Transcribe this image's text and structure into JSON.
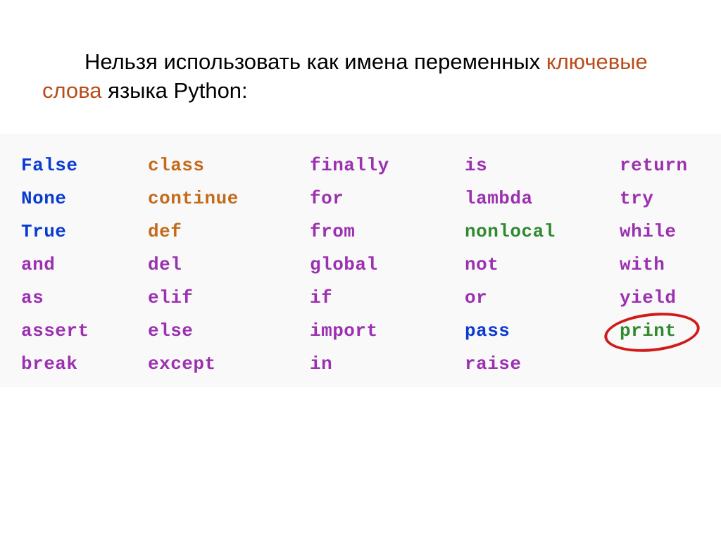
{
  "intro": {
    "part1": "Нельзя использовать как имена переменных ",
    "highlight": "ключевые слова",
    "part2": " языка Python:"
  },
  "keywords": [
    {
      "text": "False",
      "color": "blue",
      "col": 0,
      "row": 0
    },
    {
      "text": "None",
      "color": "blue",
      "col": 0,
      "row": 1
    },
    {
      "text": "True",
      "color": "blue",
      "col": 0,
      "row": 2
    },
    {
      "text": "and",
      "color": "purple",
      "col": 0,
      "row": 3
    },
    {
      "text": "as",
      "color": "purple",
      "col": 0,
      "row": 4
    },
    {
      "text": "assert",
      "color": "purple",
      "col": 0,
      "row": 5
    },
    {
      "text": "break",
      "color": "purple",
      "col": 0,
      "row": 6
    },
    {
      "text": "class",
      "color": "orange",
      "col": 1,
      "row": 0
    },
    {
      "text": "continue",
      "color": "orange",
      "col": 1,
      "row": 1
    },
    {
      "text": "def",
      "color": "orange",
      "col": 1,
      "row": 2
    },
    {
      "text": "del",
      "color": "purple",
      "col": 1,
      "row": 3
    },
    {
      "text": "elif",
      "color": "purple",
      "col": 1,
      "row": 4
    },
    {
      "text": "else",
      "color": "purple",
      "col": 1,
      "row": 5
    },
    {
      "text": "except",
      "color": "purple",
      "col": 1,
      "row": 6
    },
    {
      "text": "finally",
      "color": "purple",
      "col": 2,
      "row": 0
    },
    {
      "text": "for",
      "color": "purple",
      "col": 2,
      "row": 1
    },
    {
      "text": "from",
      "color": "purple",
      "col": 2,
      "row": 2
    },
    {
      "text": "global",
      "color": "purple",
      "col": 2,
      "row": 3
    },
    {
      "text": "if",
      "color": "purple",
      "col": 2,
      "row": 4
    },
    {
      "text": "import",
      "color": "purple",
      "col": 2,
      "row": 5
    },
    {
      "text": "in",
      "color": "purple",
      "col": 2,
      "row": 6
    },
    {
      "text": "is",
      "color": "purple",
      "col": 3,
      "row": 0
    },
    {
      "text": "lambda",
      "color": "purple",
      "col": 3,
      "row": 1
    },
    {
      "text": "nonlocal",
      "color": "green",
      "col": 3,
      "row": 2
    },
    {
      "text": "not",
      "color": "purple",
      "col": 3,
      "row": 3
    },
    {
      "text": "or",
      "color": "purple",
      "col": 3,
      "row": 4
    },
    {
      "text": "pass",
      "color": "blue",
      "col": 3,
      "row": 5
    },
    {
      "text": "raise",
      "color": "purple",
      "col": 3,
      "row": 6
    },
    {
      "text": "return",
      "color": "purple",
      "col": 4,
      "row": 0
    },
    {
      "text": "try",
      "color": "purple",
      "col": 4,
      "row": 1
    },
    {
      "text": "while",
      "color": "purple",
      "col": 4,
      "row": 2
    },
    {
      "text": "with",
      "color": "purple",
      "col": 4,
      "row": 3
    },
    {
      "text": "yield",
      "color": "purple",
      "col": 4,
      "row": 4
    },
    {
      "text": "print",
      "color": "green",
      "col": 4,
      "row": 5,
      "circled": true
    }
  ],
  "layout": {
    "colX": [
      30,
      210,
      440,
      660,
      880
    ],
    "rowStart": 30,
    "rowStep": 47
  }
}
